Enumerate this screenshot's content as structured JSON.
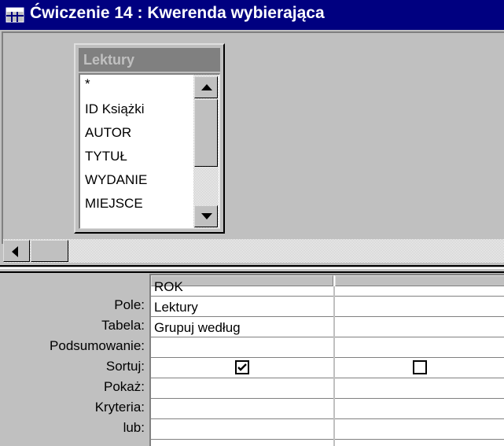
{
  "window": {
    "title": "Ćwiczenie 14 : Kwerenda wybierająca",
    "icon": "query-grid-icon"
  },
  "field_list": {
    "table_name": "Lektury",
    "fields": [
      "*",
      "ID Książki",
      "AUTOR",
      "TYTUŁ",
      "WYDANIE",
      "MIEJSCE"
    ]
  },
  "grid": {
    "row_labels": [
      "Pole:",
      "Tabela:",
      "Podsumowanie:",
      "Sortuj:",
      "Pokaż:",
      "Kryteria:",
      "lub:"
    ],
    "columns": [
      {
        "field": "ROK",
        "table": "Lektury",
        "total": "Grupuj według",
        "sort": "",
        "show": true,
        "criteria": "",
        "or": ""
      },
      {
        "field": "",
        "table": "",
        "total": "",
        "sort": "",
        "show": false,
        "criteria": "",
        "or": ""
      }
    ]
  },
  "colors": {
    "title_bar": "#000080",
    "face": "#c0c0c0",
    "shadow": "#808080"
  }
}
